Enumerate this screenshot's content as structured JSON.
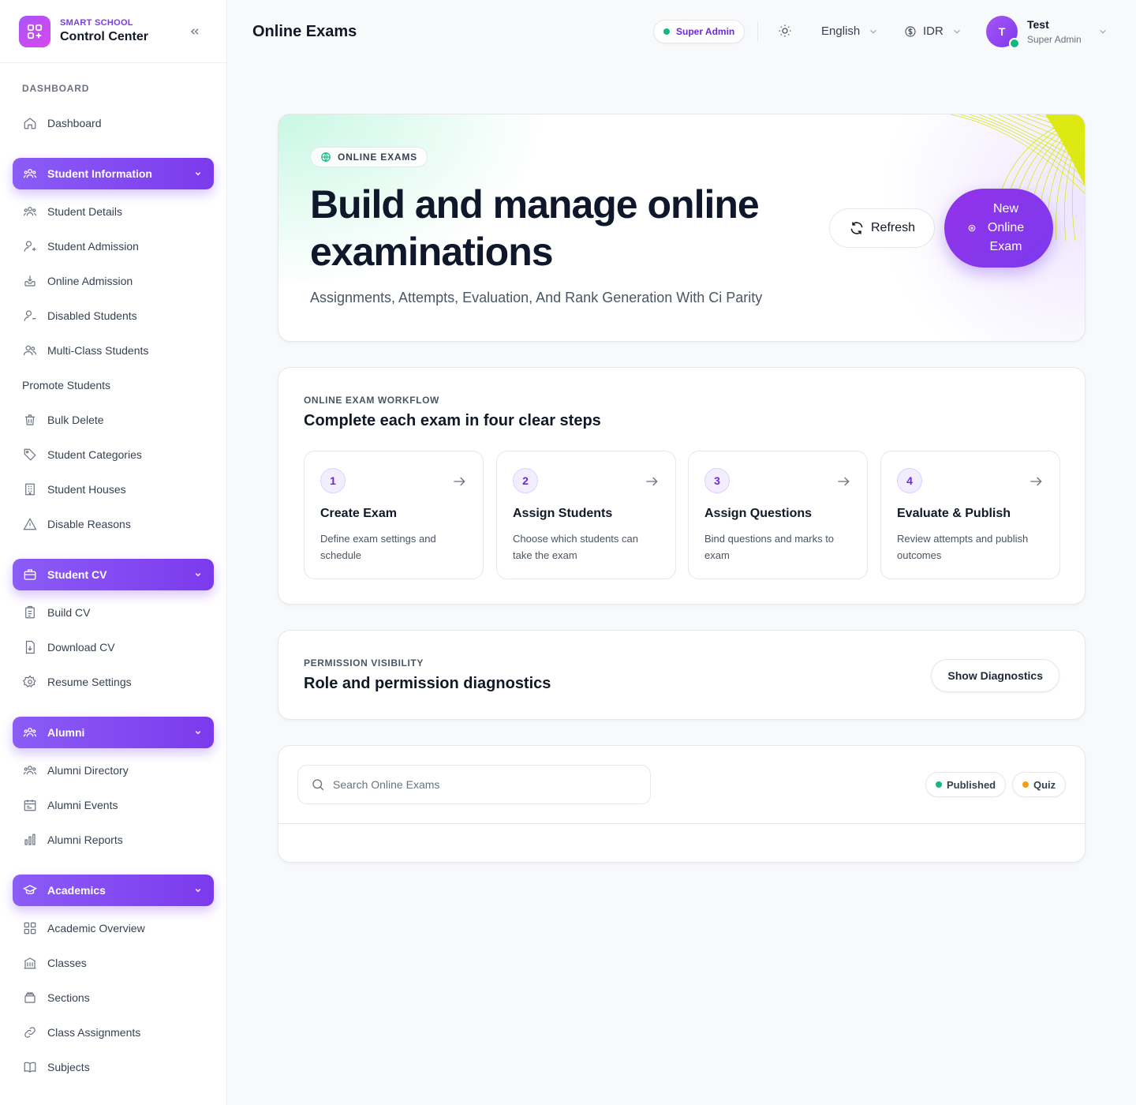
{
  "brand": {
    "subtitle": "SMART SCHOOL",
    "title": "Control Center"
  },
  "sidebar": {
    "dashboard_label": "DASHBOARD",
    "dashboard_item": "Dashboard",
    "groups": [
      {
        "label": "Student Information",
        "items": [
          "Student Details",
          "Student Admission",
          "Online Admission",
          "Disabled Students",
          "Multi-Class Students",
          "Promote Students",
          "Bulk Delete",
          "Student Categories",
          "Student Houses",
          "Disable Reasons"
        ]
      },
      {
        "label": "Student CV",
        "items": [
          "Build CV",
          "Download CV",
          "Resume Settings"
        ]
      },
      {
        "label": "Alumni",
        "items": [
          "Alumni Directory",
          "Alumni Events",
          "Alumni Reports"
        ]
      },
      {
        "label": "Academics",
        "items": [
          "Academic Overview",
          "Classes",
          "Sections",
          "Class Assignments",
          "Subjects"
        ]
      }
    ]
  },
  "topbar": {
    "title": "Online Exams",
    "role_badge": "Super Admin",
    "language": "English",
    "currency": "IDR",
    "user": {
      "initial": "T",
      "name": "Test",
      "role": "Super Admin"
    }
  },
  "hero": {
    "tag": "ONLINE EXAMS",
    "title": "Build and manage online examinations",
    "subtitle": "Assignments, Attempts, Evaluation, And Rank Generation With Ci Parity",
    "refresh_label": "Refresh",
    "new_label": "New Online Exam"
  },
  "workflow": {
    "kicker": "ONLINE EXAM WORKFLOW",
    "title": "Complete each exam in four clear steps",
    "steps": [
      {
        "num": "1",
        "title": "Create Exam",
        "desc": "Define exam settings and schedule"
      },
      {
        "num": "2",
        "title": "Assign Students",
        "desc": "Choose which students can take the exam"
      },
      {
        "num": "3",
        "title": "Assign Questions",
        "desc": "Bind questions and marks to exam"
      },
      {
        "num": "4",
        "title": "Evaluate & Publish",
        "desc": "Review attempts and publish outcomes"
      }
    ]
  },
  "permissions": {
    "kicker": "PERMISSION VISIBILITY",
    "title": "Role and permission diagnostics",
    "button": "Show Diagnostics"
  },
  "search": {
    "placeholder": "Search Online Exams",
    "chips": [
      {
        "label": "Published",
        "color": "#10b981"
      },
      {
        "label": "Quiz",
        "color": "#f59e0b"
      }
    ]
  },
  "colors": {
    "accent": "#7c3aed",
    "success": "#10b981",
    "warning": "#f59e0b"
  }
}
